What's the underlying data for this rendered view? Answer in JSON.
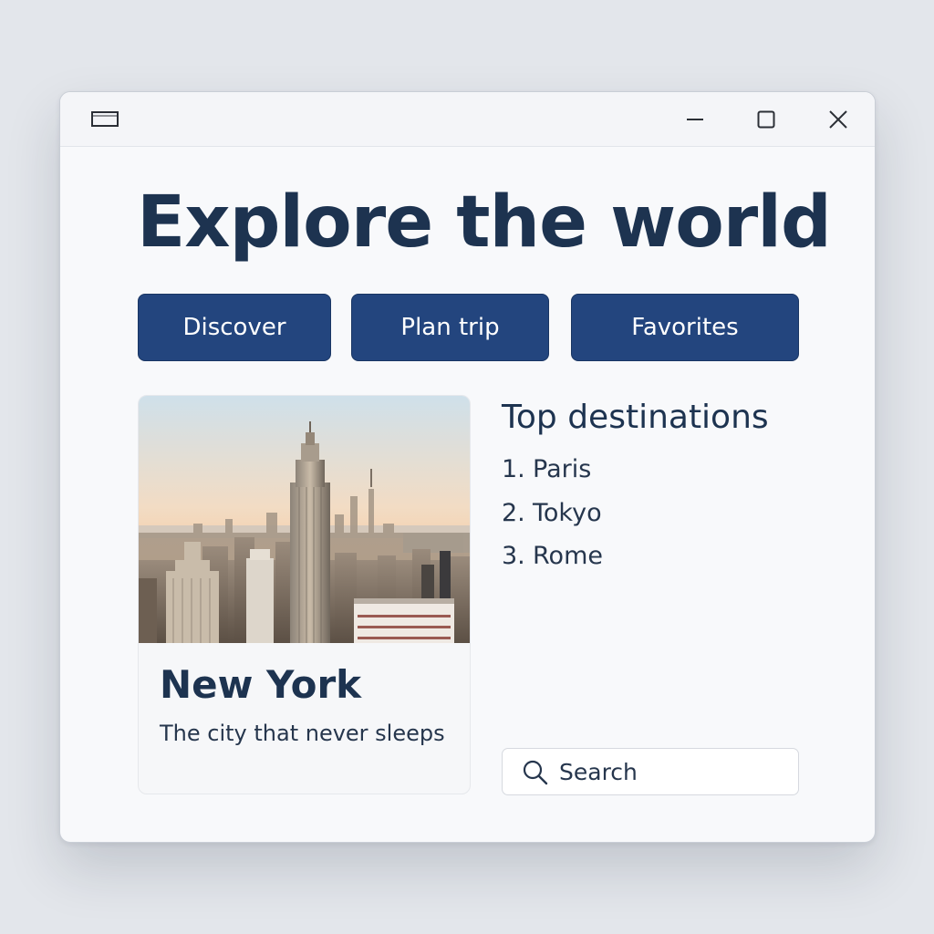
{
  "window": {
    "controls": {
      "minimize_icon": "minimize-icon",
      "maximize_icon": "maximize-icon",
      "close_icon": "close-icon"
    }
  },
  "header": {
    "title": "Explore the world"
  },
  "nav": {
    "buttons": [
      {
        "label": "Discover"
      },
      {
        "label": "Plan trip"
      },
      {
        "label": "Favorites"
      }
    ]
  },
  "featured": {
    "image_desc": "city-skyline-photo",
    "title": "New York",
    "subtitle": "The city that never sleeps"
  },
  "destinations": {
    "heading": "Top destinations",
    "items": [
      {
        "number": "1.",
        "name": "Paris"
      },
      {
        "number": "2.",
        "name": "Tokyo"
      },
      {
        "number": "3.",
        "name": "Rome"
      }
    ]
  },
  "search": {
    "label": "Search",
    "icon": "search-icon"
  },
  "colors": {
    "accent": "#23457e",
    "heading": "#1d3350",
    "background": "#f8f9fb"
  }
}
